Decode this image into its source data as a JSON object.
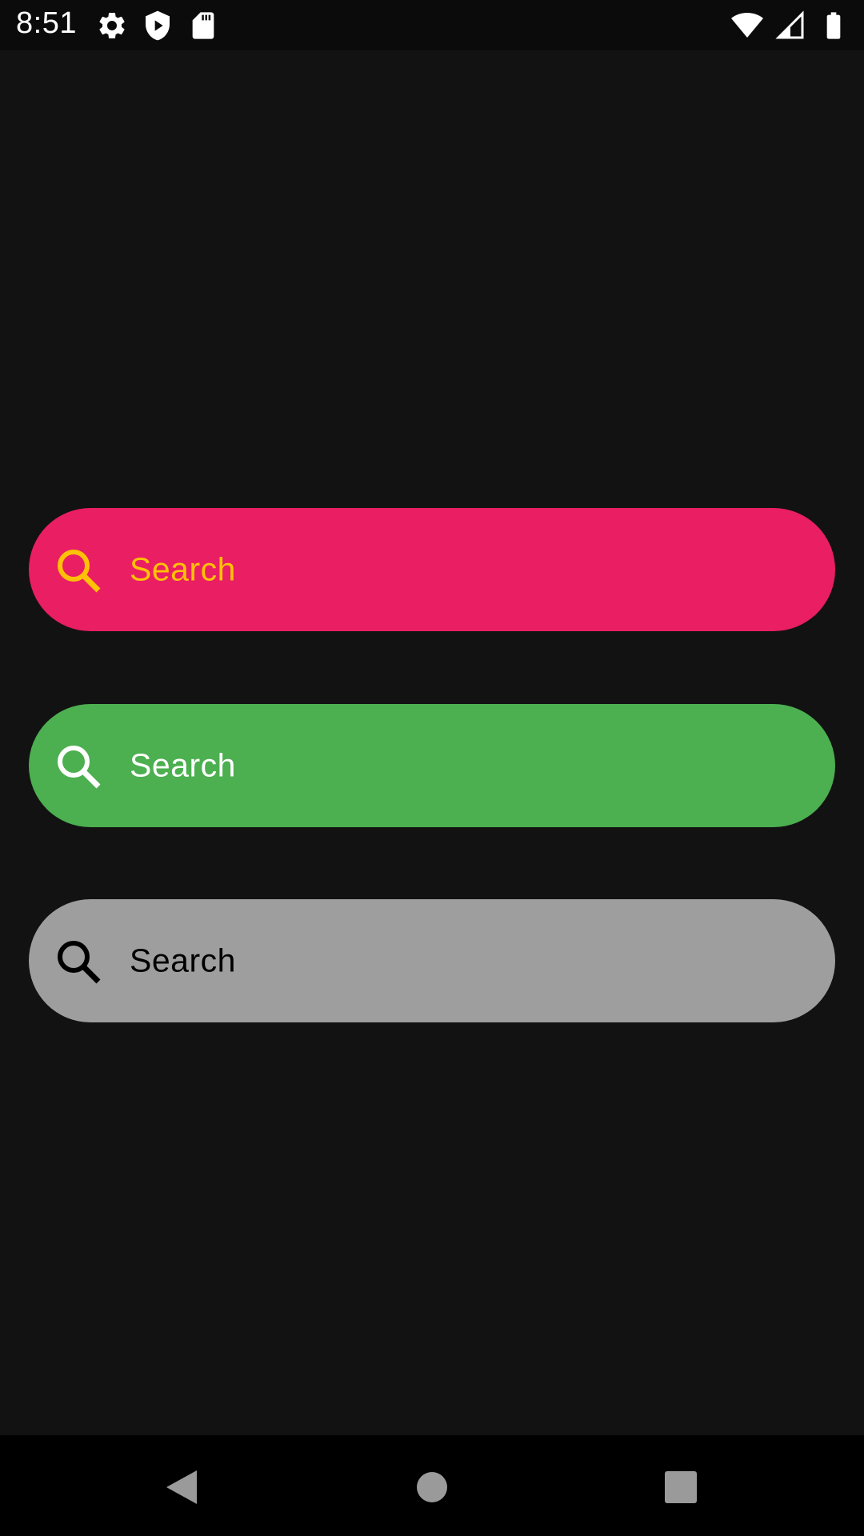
{
  "status_bar": {
    "time": "8:51",
    "left_icons": [
      "gear-icon",
      "shield-play-icon",
      "sd-card-icon"
    ],
    "right_icons": [
      "wifi-icon",
      "cell-signal-icon",
      "battery-icon"
    ]
  },
  "search_bars": [
    {
      "placeholder": "Search",
      "background": "#E91E63",
      "foreground": "#FFC107",
      "icon": "search-icon"
    },
    {
      "placeholder": "Search",
      "background": "#4CAF50",
      "foreground": "#FFFFFF",
      "icon": "search-icon"
    },
    {
      "placeholder": "Search",
      "background": "#9E9E9E",
      "foreground": "#000000",
      "icon": "search-icon"
    }
  ],
  "nav_bar": {
    "buttons": [
      "back-icon",
      "home-icon",
      "recents-icon"
    ]
  }
}
